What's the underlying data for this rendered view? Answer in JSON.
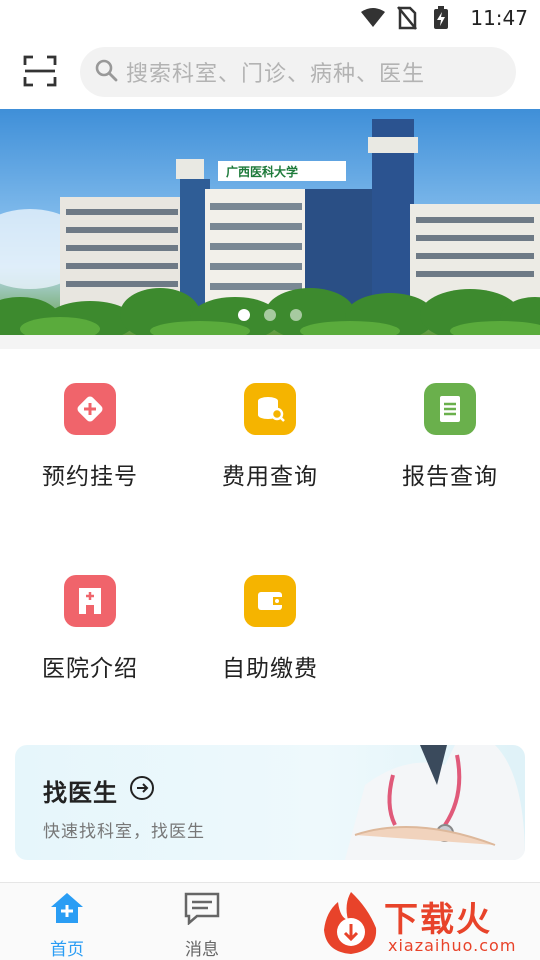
{
  "status_bar": {
    "time": "11:47",
    "icons": [
      "wifi-icon",
      "no-sim-icon",
      "battery-charging-icon"
    ]
  },
  "header": {
    "scan_icon": "scan-icon",
    "search": {
      "icon": "search-icon",
      "placeholder": "搜索科室、门诊、病种、医生"
    }
  },
  "banner": {
    "sign_text": "广西医科大学",
    "slide_count": 3,
    "active_slide": 1
  },
  "grid": {
    "items": [
      {
        "label": "预约挂号",
        "icon": "appointment-icon",
        "color": "#f0646b"
      },
      {
        "label": "费用查询",
        "icon": "fee-query-icon",
        "color": "#f5b400"
      },
      {
        "label": "报告查询",
        "icon": "report-query-icon",
        "color": "#6ab04c"
      },
      {
        "label": "医院介绍",
        "icon": "hospital-intro-icon",
        "color": "#f0646b"
      },
      {
        "label": "自助缴费",
        "icon": "self-payment-icon",
        "color": "#f5b400"
      }
    ]
  },
  "doctor_card": {
    "title": "找医生",
    "subtitle": "快速找科室，找医生",
    "arrow_icon": "arrow-right-circle-icon"
  },
  "bottom_nav": {
    "items": [
      {
        "label": "首页",
        "icon": "home-icon",
        "active": true
      },
      {
        "label": "消息",
        "icon": "message-icon",
        "active": false
      }
    ],
    "active_color": "#2a9df4"
  },
  "watermark": {
    "text": "下载火",
    "url": "xiazaihuo.com"
  }
}
